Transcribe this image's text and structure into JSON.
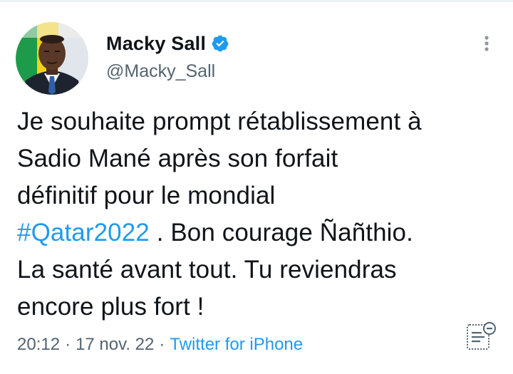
{
  "author": {
    "display_name": "Macky Sall",
    "handle": "@Macky_Sall",
    "verified": true
  },
  "tweet": {
    "lines": [
      {
        "text": "Je souhaite prompt rétablissement à"
      },
      {
        "text": "Sadio Mané après son forfait"
      },
      {
        "text": "définitif pour le mondial"
      },
      {
        "hashtag": "#Qatar2022",
        "text": " . Bon courage Ñañthio."
      },
      {
        "text": "La santé avant tout. Tu reviendras"
      },
      {
        "text": "encore plus fort !"
      }
    ]
  },
  "meta": {
    "time": "20:12",
    "separator": "·",
    "date": "17 nov. 22",
    "source": "Twitter for iPhone"
  },
  "colors": {
    "link": "#1d9bf0",
    "secondary_text": "#536471",
    "primary_text": "#0f1419",
    "verified_badge": "#1d9bf0"
  },
  "icons": {
    "verified": "verified-badge-icon",
    "more": "more-options-icon",
    "analytics": "analytics-icon"
  }
}
